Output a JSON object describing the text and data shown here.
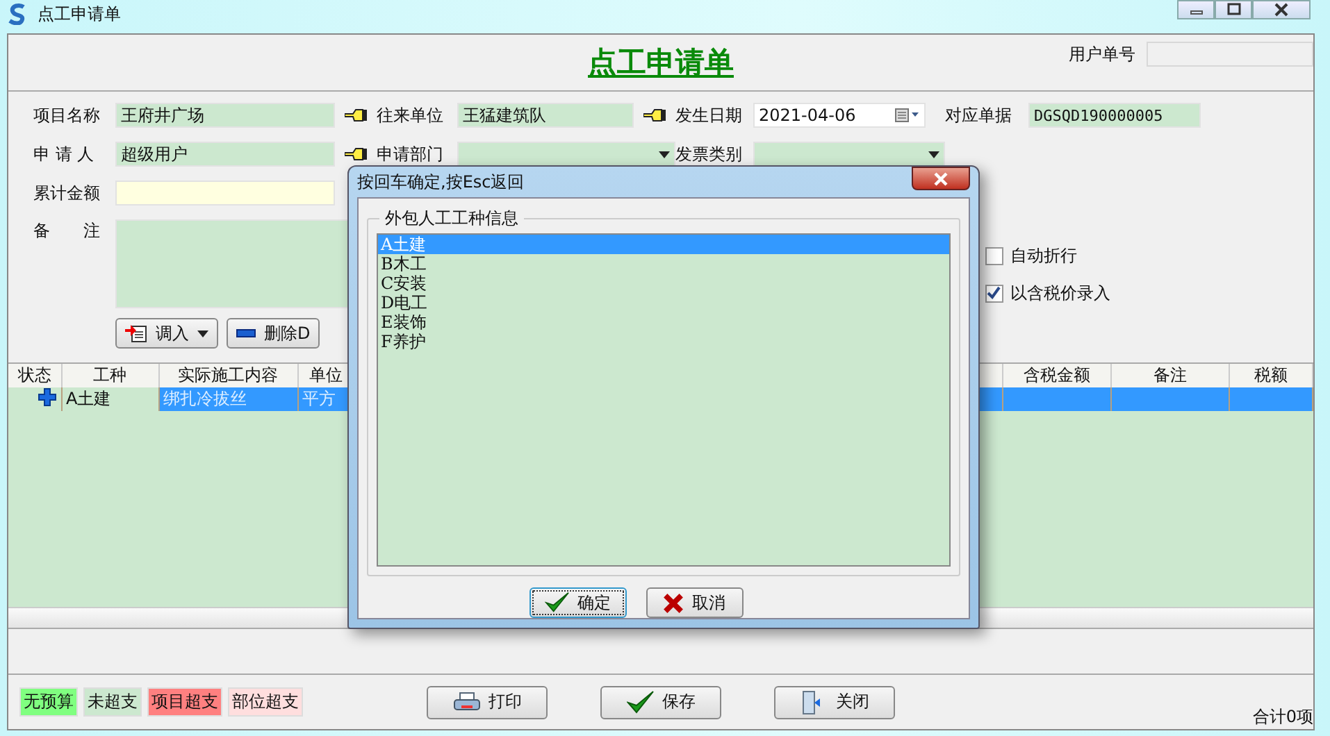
{
  "window": {
    "title": "点工申请单"
  },
  "header": {
    "title": "点工申请单",
    "user_no_label": "用户单号"
  },
  "form": {
    "rows": [
      [
        {
          "label": "项目名称",
          "value": "王府井广场",
          "kind": "lookup"
        },
        {
          "label": "往来单位",
          "value": "王猛建筑队",
          "kind": "lookup"
        },
        {
          "label": "发生日期",
          "value": "2021-04-06",
          "kind": "date"
        },
        {
          "label": "对应单据",
          "value": "DGSQD190000005",
          "kind": "text"
        }
      ],
      [
        {
          "label": "申 请 人",
          "value": "超级用户",
          "kind": "lookup"
        },
        {
          "label": "申请部门",
          "kind": "combo"
        },
        {
          "label": "发票类别",
          "kind": "combo"
        }
      ],
      [
        {
          "label": "累计金额",
          "kind": "amount"
        }
      ]
    ],
    "memo_label": "备　　注",
    "checkboxes": [
      {
        "label": "自动折行",
        "checked": false
      },
      {
        "label": "以含税价录入",
        "checked": true
      }
    ],
    "buttons": [
      {
        "label": "调入",
        "kind": "import"
      },
      {
        "label": "删除D",
        "kind": "delete"
      }
    ]
  },
  "table": {
    "columns": [
      "状态",
      "工种",
      "实际施工内容",
      "单位",
      "含税金额",
      "备注",
      "税额"
    ],
    "rows": [
      {
        "selected": true,
        "work_type": "A土建",
        "content": "绑扎冷拔丝",
        "unit": "平方"
      }
    ]
  },
  "legend": [
    {
      "label": "无预算",
      "color": "#80ff80"
    },
    {
      "label": "未超支",
      "color": "#cce8cf"
    },
    {
      "label": "项目超支",
      "color": "#ff8080"
    },
    {
      "label": "部位超支",
      "color": "#ffdede"
    }
  ],
  "buttons": [
    {
      "label": "打印",
      "kind": "print"
    },
    {
      "label": "保存",
      "kind": "save"
    },
    {
      "label": "关闭",
      "kind": "close"
    }
  ],
  "status": "合计0项",
  "dialog": {
    "title": "按回车确定,按Esc返回",
    "group": "外包人工工种信息",
    "items": [
      {
        "label": "A土建",
        "selected": true
      },
      {
        "label": "B木工",
        "selected": false
      },
      {
        "label": "C安装",
        "selected": false
      },
      {
        "label": "D电工",
        "selected": false
      },
      {
        "label": "E装饰",
        "selected": false
      },
      {
        "label": "F养护",
        "selected": false
      }
    ],
    "buttons": [
      {
        "label": "确定",
        "kind": "ok"
      },
      {
        "label": "取消",
        "kind": "cancel"
      }
    ]
  }
}
